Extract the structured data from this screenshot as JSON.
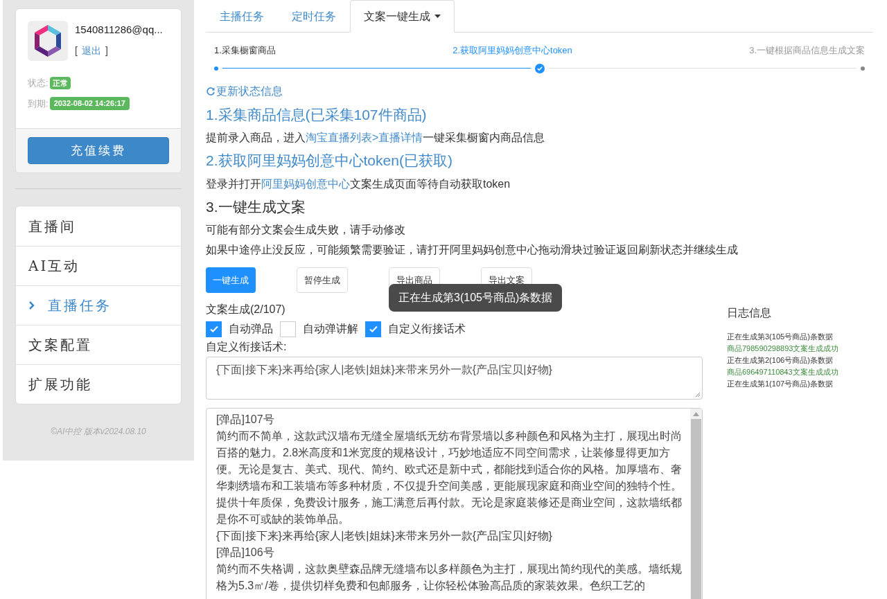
{
  "account": {
    "email": "1540811286@qq...",
    "logout_open": "[",
    "logout": "退出",
    "logout_close": "]",
    "status_label": "状态:",
    "status": "正常",
    "expiry_label": "到期:",
    "expiry": "2032-08-02 14:26:17",
    "recharge": "充值续费"
  },
  "nav": [
    {
      "label": "直播间",
      "selected": false
    },
    {
      "label": "AI互动",
      "selected": false
    },
    {
      "label": "直播任务",
      "selected": true
    },
    {
      "label": "文案配置",
      "selected": false
    },
    {
      "label": "扩展功能",
      "selected": false
    }
  ],
  "footer": "©AI中控 版本v2024.08.10",
  "tabs": [
    {
      "label": "主播任务",
      "selected": false,
      "dropdown": false
    },
    {
      "label": "定时任务",
      "selected": false,
      "dropdown": false
    },
    {
      "label": "文案一键生成",
      "selected": true,
      "dropdown": true
    }
  ],
  "steps": [
    {
      "label": "1.采集橱窗商品",
      "kind": "done"
    },
    {
      "label": "2.获取阿里妈妈创意中心token",
      "kind": "active"
    },
    {
      "label": "3.一键根据商品信息生成文案",
      "kind": "pending"
    }
  ],
  "refresh": "更新状态信息",
  "sections": [
    {
      "heading": "1.采集商品信息(已采集107件商品)",
      "done": true,
      "paragraphs": [
        [
          {
            "kind": "text",
            "text": "提前录入商品，进入"
          },
          {
            "kind": "link",
            "text": "淘宝直播列表>直播详情"
          },
          {
            "kind": "text",
            "text": "一键采集橱窗内商品信息"
          }
        ]
      ]
    },
    {
      "heading": "2.获取阿里妈妈创意中心token(已获取)",
      "done": true,
      "paragraphs": [
        [
          {
            "kind": "text",
            "text": "登录并打开"
          },
          {
            "kind": "link",
            "text": "阿里妈妈创意中心"
          },
          {
            "kind": "text",
            "text": "文案生成页面等待自动获取token"
          }
        ]
      ]
    },
    {
      "heading": "3.一键生成文案",
      "done": false,
      "paragraphs": [
        [
          {
            "kind": "text",
            "text": "可能有部分文案会生成失败，请手动修改"
          }
        ],
        [
          {
            "kind": "text",
            "text": "如果中途停止没反应，可能频繁需要验证，请打开阿里妈妈创意中心拖动滑块过验证返回刷新状态并继续生成"
          }
        ]
      ]
    }
  ],
  "buttons": [
    {
      "label": "一键生成",
      "primary": true
    },
    {
      "label": "暂停生成",
      "primary": false
    },
    {
      "label": "导出商品",
      "primary": false
    },
    {
      "label": "导出文案",
      "primary": false
    }
  ],
  "toast": "正在生成第3(105号商品)条数据",
  "progress": "文案生成(2/107)",
  "options": [
    {
      "label": "自动弹品",
      "checked": true
    },
    {
      "label": "自动弹讲解",
      "checked": false
    },
    {
      "label": "自定义衔接话术",
      "checked": true
    }
  ],
  "transition_label": "自定义衔接话术:",
  "transition_value": "{下面|接下来}来再给{家人|老铁|姐妹}来带来另外一款{产品|宝贝|好物}",
  "output_lines": [
    "[弹品]107号",
    "简约而不简单，这款武汉墙布无缝全屋墙纸无纺布背景墙以多种颜色和风格为主打，展现出时尚百搭的魅力。2.8米高度和1米宽度的规格设计，巧妙地适应不同空间需求，让装修显得更加方便。无论是复古、美式、现代、简约、欧式还是新中式，都能找到适合你的风格。加厚墙布、奢华刺绣墙布和工装墙布等多种材质，不仅提升空间美感，更能展现家庭和商业空间的独特个性。提供十年质保，免费设计服务，施工满意后再付款。无论是家庭装修还是商业空间，这款墙纸都是你不可或缺的装饰单品。",
    "{下面|接下来}来再给{家人|老铁|姐妹}来带来另外一款{产品|宝贝|好物}",
    "[弹品]106号",
    "简约而不失格调，这款奥壁森品牌无缝墙布以多样颜色为主打，展现出简约现代的美感。墙纸规格为5.3㎡/卷，提供切样免费和包邮服务，让你轻松体验高品质的家装效果。色织工艺的"
  ],
  "log": {
    "title": "日志信息",
    "entries": [
      {
        "text": "正在生成第3(105号商品)条数据",
        "kind": "info"
      },
      {
        "text": "商品798590298893文案生成成功",
        "kind": "success"
      },
      {
        "text": "正在生成第2(106号商品)条数据",
        "kind": "info"
      },
      {
        "text": "商品696497110843文案生成成功",
        "kind": "success"
      },
      {
        "text": "正在生成第1(107号商品)条数据",
        "kind": "info"
      }
    ]
  }
}
